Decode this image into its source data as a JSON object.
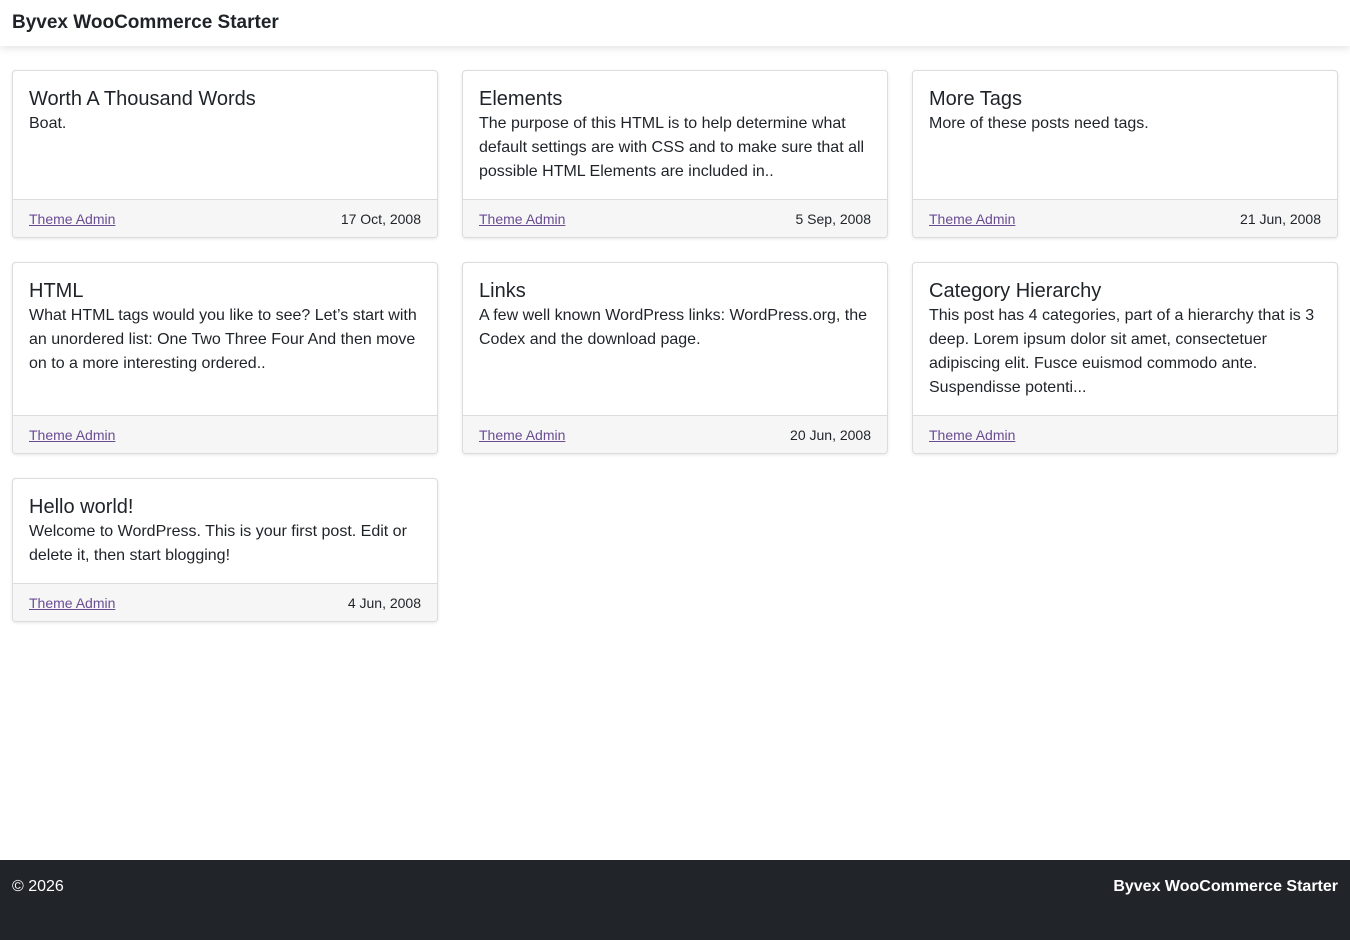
{
  "header": {
    "site_title": "Byvex WooCommerce Starter"
  },
  "posts": [
    {
      "title": "Worth A Thousand Words",
      "excerpt": "Boat.",
      "author": "Theme Admin",
      "date": "17 Oct, 2008"
    },
    {
      "title": "Elements",
      "excerpt": "The purpose of this HTML is to help determine what default settings are with CSS and to make sure that all possible HTML Elements are included in..",
      "author": "Theme Admin",
      "date": "5 Sep, 2008"
    },
    {
      "title": "More Tags",
      "excerpt": "More of these posts need tags.",
      "author": "Theme Admin",
      "date": "21 Jun, 2008"
    },
    {
      "title": "HTML",
      "excerpt": "What HTML tags would you like to see? Let’s start with an unordered list: One Two Three Four And then move on to a more interesting ordered..",
      "author": "Theme Admin",
      "date": ""
    },
    {
      "title": "Links",
      "excerpt": "A few well known WordPress links: WordPress.org, the Codex and the download page.",
      "author": "Theme Admin",
      "date": "20 Jun, 2008"
    },
    {
      "title": "Category Hierarchy",
      "excerpt": "This post has 4 categories, part of a hierarchy that is 3 deep. Lorem ipsum dolor sit amet, consectetuer adipiscing elit. Fusce euismod commodo ante. Suspendisse potenti...",
      "author": "Theme Admin",
      "date": ""
    },
    {
      "title": "Hello world!",
      "excerpt": "Welcome to WordPress. This is your first post. Edit or delete it, then start blogging!",
      "author": "Theme Admin",
      "date": "4 Jun, 2008"
    }
  ],
  "footer": {
    "copyright": "© 2026",
    "brand": "Byvex WooCommerce Starter"
  },
  "colors": {
    "link": "#6a4c93",
    "footer_bg": "#212529",
    "card_footer_bg": "#f6f6f6"
  }
}
